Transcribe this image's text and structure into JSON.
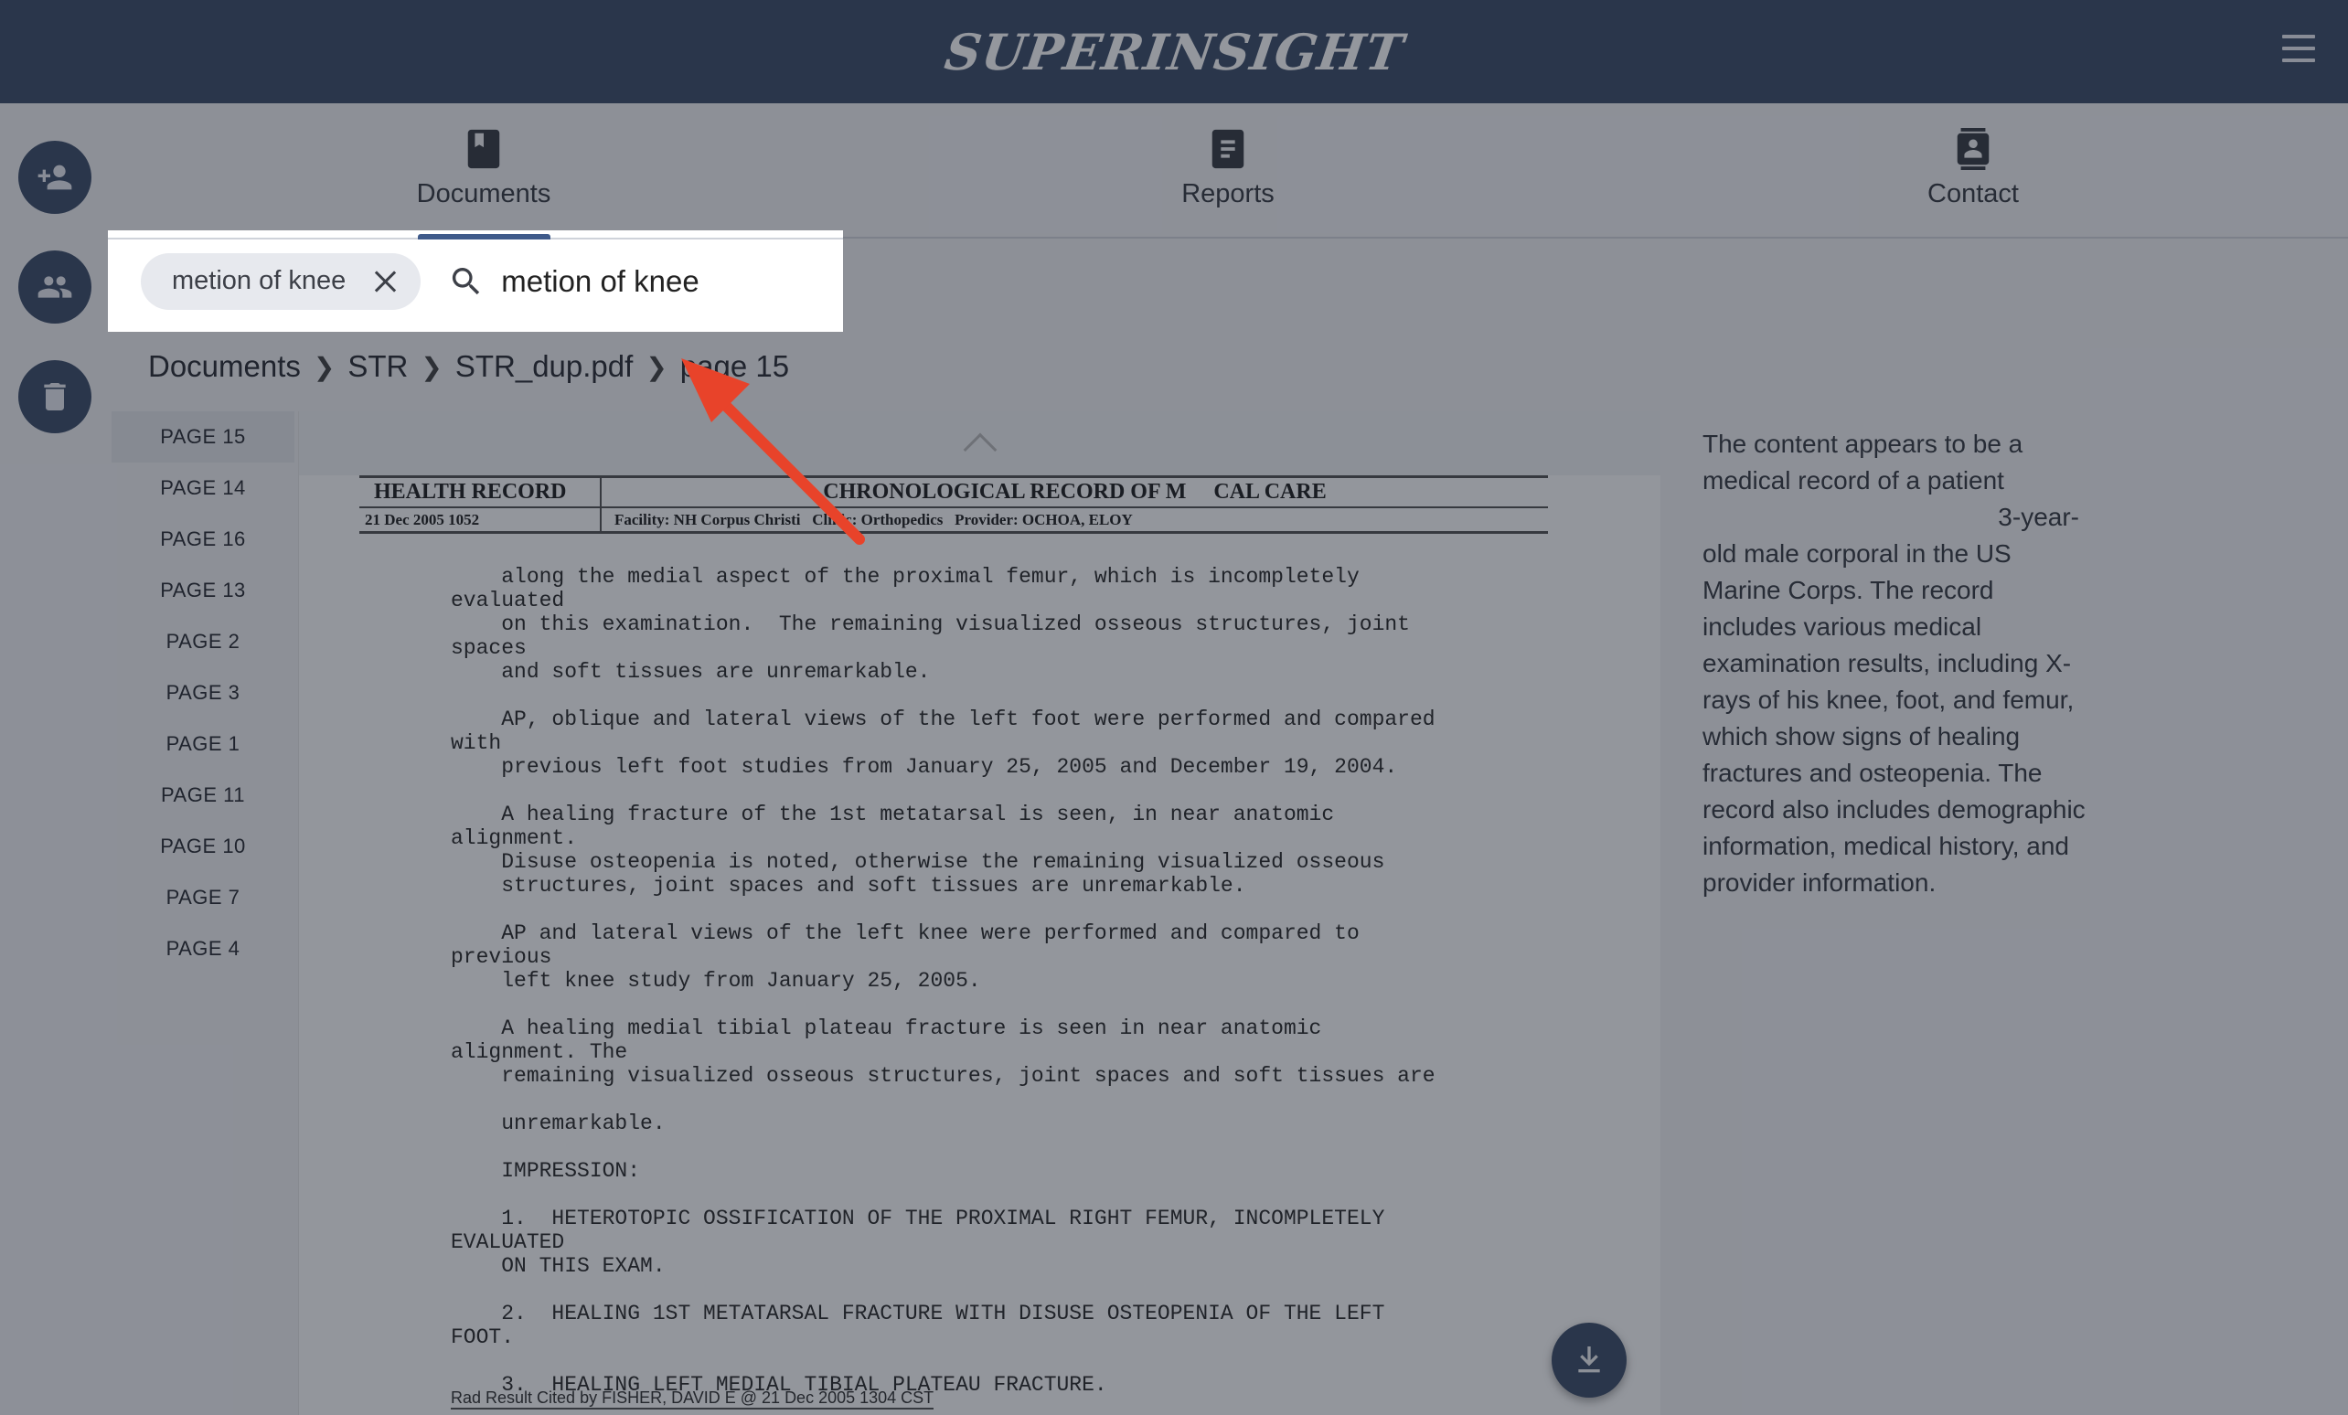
{
  "header": {
    "brand": "SUPERINSIGHT",
    "menu_icon": "hamburger-menu-icon"
  },
  "side_actions": [
    {
      "name": "add-user",
      "icon": "person-add-icon"
    },
    {
      "name": "group",
      "icon": "group-icon"
    },
    {
      "name": "delete",
      "icon": "trash-icon"
    }
  ],
  "tabs": [
    {
      "label": "Documents",
      "icon": "book-icon",
      "active": true
    },
    {
      "label": "Reports",
      "icon": "report-icon",
      "active": false
    },
    {
      "label": "Contact",
      "icon": "contact-icon",
      "active": false
    }
  ],
  "search": {
    "chip_label": "metion of knee",
    "value": "metion of knee",
    "placeholder": ""
  },
  "breadcrumb": [
    "Documents",
    "STR",
    "STR_dup.pdf",
    "page 15"
  ],
  "pages": [
    "PAGE 15",
    "PAGE 14",
    "PAGE 16",
    "PAGE 13",
    "PAGE 2",
    "PAGE 3",
    "PAGE 1",
    "PAGE 11",
    "PAGE 10",
    "PAGE 7",
    "PAGE 4"
  ],
  "active_page": "PAGE 15",
  "document": {
    "header_title": "HEALTH RECORD",
    "header_chrono": "CHRONOLOGICAL RECORD OF M     CAL CARE",
    "header_datetime": "21 Dec 2005 1052",
    "header_facility": "Facility: NH Corpus Christi   Clinic: Orthopedics   Provider: OCHOA, ELOY",
    "body": "    along the medial aspect of the proximal femur, which is incompletely\nevaluated\n    on this examination.  The remaining visualized osseous structures, joint\nspaces\n    and soft tissues are unremarkable.\n\n    AP, oblique and lateral views of the left foot were performed and compared\nwith\n    previous left foot studies from January 25, 2005 and December 19, 2004.\n\n    A healing fracture of the 1st metatarsal is seen, in near anatomic\nalignment.\n    Disuse osteopenia is noted, otherwise the remaining visualized osseous\n    structures, joint spaces and soft tissues are unremarkable.\n\n    AP and lateral views of the left knee were performed and compared to\nprevious\n    left knee study from January 25, 2005.\n\n    A healing medial tibial plateau fracture is seen in near anatomic\nalignment. The\n    remaining visualized osseous structures, joint spaces and soft tissues are\n\n    unremarkable.\n\n    IMPRESSION:\n\n    1.  HETEROTOPIC OSSIFICATION OF THE PROXIMAL RIGHT FEMUR, INCOMPLETELY\nEVALUATED\n    ON THIS EXAM.\n\n    2.  HEALING 1ST METATARSAL FRACTURE WITH DISUSE OSTEOPENIA OF THE LEFT\nFOOT.\n\n    3.  HEALING LEFT MEDIAL TIBIAL PLATEAU FRACTURE.",
    "footer": "Rad Result Cited by FISHER, DAVID E @ 21 Dec 2005 1304 CST"
  },
  "summary": {
    "line1": "The content appears to be a medical record of a patient",
    "fragment": "3-year-",
    "line2": "old male corporal in the US Marine Corps. The record includes various medical examination results, including X-rays of his knee, foot, and femur, which show signs of healing fractures and osteopenia. The record also includes demographic information, medical history, and provider information."
  },
  "colors": {
    "header_bg": "#3f4f6b",
    "accent": "#3f5a8a",
    "annotation_arrow": "#e8432a"
  }
}
